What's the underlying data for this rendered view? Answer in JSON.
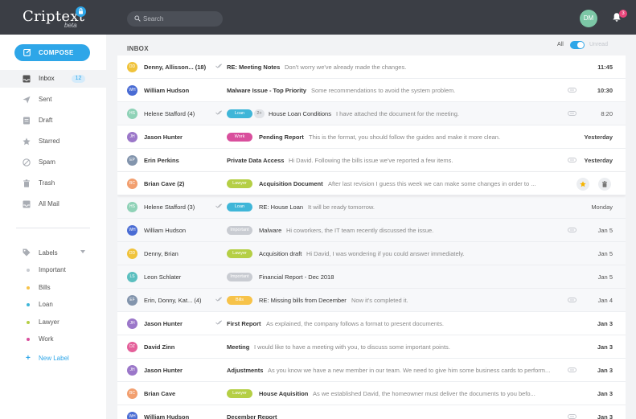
{
  "app": {
    "name": "Criptext",
    "beta": "beta",
    "icons": {
      "lock": "lock-icon",
      "search": "search-icon",
      "bell": "bell-icon"
    }
  },
  "search": {
    "placeholder": "Search"
  },
  "user": {
    "initials": "DM",
    "notification_count": "3"
  },
  "compose": {
    "label": "COMPOSE",
    "icon": "compose-icon"
  },
  "nav": [
    {
      "label": "Inbox",
      "count": "12",
      "icon": "inbox-icon"
    },
    {
      "label": "Sent",
      "icon": "send-icon"
    },
    {
      "label": "Draft",
      "icon": "draft-icon"
    },
    {
      "label": "Starred",
      "icon": "star-icon"
    },
    {
      "label": "Spam",
      "icon": "spam-icon"
    },
    {
      "label": "Trash",
      "icon": "trash-icon"
    },
    {
      "label": "All Mail",
      "icon": "all-mail-icon"
    }
  ],
  "labels": {
    "title": "Labels",
    "items": [
      {
        "name": "Important",
        "color": "#c9ccd2"
      },
      {
        "name": "Bills",
        "color": "#f7c34a"
      },
      {
        "name": "Loan",
        "color": "#3fb6d8"
      },
      {
        "name": "Lawyer",
        "color": "#b5cf45"
      },
      {
        "name": "Work",
        "color": "#d94f9d"
      }
    ],
    "new_label": "New Label"
  },
  "inbox": {
    "title": "INBOX",
    "filter_all": "All",
    "filter_unread": "Unread",
    "emails": [
      {
        "initials": "DD",
        "avatar_color": "#f0c33c",
        "from": "Denny, Allisson... (18)",
        "subject": "RE: Meeting Notes",
        "preview": "Don't worry we've already made the changes.",
        "time": "11:45",
        "unread": true,
        "check": true,
        "label": null,
        "thread": null,
        "attachment": false
      },
      {
        "initials": "WH",
        "avatar_color": "#4a6cd4",
        "from": "William Hudson",
        "subject": "Malware Issue - Top Priority",
        "preview": "Some recommendations to avoid the system problem.",
        "time": "10:30",
        "unread": true,
        "check": false,
        "label": null,
        "thread": null,
        "attachment": true
      },
      {
        "initials": "HS",
        "avatar_color": "#8fd2b7",
        "from": "Helene Stafford (4)",
        "subject": "House Loan Conditions",
        "preview": "I have attached the document for the meeting.",
        "time": "8:20",
        "unread": false,
        "check": true,
        "label": {
          "text": "Loan",
          "color": "#3fb6d8"
        },
        "thread": "2+",
        "attachment": true
      },
      {
        "initials": "JH",
        "avatar_color": "#9b77c9",
        "from": "Jason Hunter",
        "subject": "Pending Report",
        "preview": "This is the format, you should follow the guides and make it more clean.",
        "time": "Yesterday",
        "unread": true,
        "check": false,
        "label": {
          "text": "Work",
          "color": "#d94f9d"
        },
        "thread": null,
        "attachment": false
      },
      {
        "initials": "EP",
        "avatar_color": "#8395ad",
        "from": "Erin Perkins",
        "subject": "Private Data Access",
        "preview": "Hi David. Following the bills issue we've reported a few items.",
        "time": "Yesterday",
        "unread": true,
        "check": false,
        "label": null,
        "thread": null,
        "attachment": true
      },
      {
        "initials": "BC",
        "avatar_color": "#f29f6f",
        "from": "Brian Cave (2)",
        "subject": "Acquisition Document",
        "preview": "After last revision I guess this week we can make some changes in order to ...",
        "time": "",
        "unread": true,
        "check": false,
        "label": {
          "text": "Lawyer",
          "color": "#b5cf45"
        },
        "thread": null,
        "attachment": false,
        "hover": true
      },
      {
        "initials": "HS",
        "avatar_color": "#8fd2b7",
        "from": "Helene Stafford (3)",
        "subject": "RE: House Loan",
        "preview": "It will be ready tomorrow.",
        "time": "Monday",
        "unread": false,
        "check": true,
        "label": {
          "text": "Loan",
          "color": "#3fb6d8"
        },
        "thread": null,
        "attachment": false
      },
      {
        "initials": "WH",
        "avatar_color": "#4a6cd4",
        "from": "William Hudson",
        "subject": "Malware",
        "preview": "Hi coworkers, the IT team recently discussed the issue.",
        "time": "Jan 5",
        "unread": false,
        "check": false,
        "label": {
          "text": "Important",
          "color": "#c9ccd2"
        },
        "thread": null,
        "attachment": true
      },
      {
        "initials": "DD",
        "avatar_color": "#f0c33c",
        "from": "Denny, Brian",
        "subject": "Acquisition draft",
        "preview": "Hi David, I was wondering if you could answer immediately.",
        "time": "Jan 5",
        "unread": false,
        "check": false,
        "label": {
          "text": "Lawyer",
          "color": "#b5cf45"
        },
        "thread": null,
        "attachment": false
      },
      {
        "initials": "LS",
        "avatar_color": "#5bbfbf",
        "from": "Leon Schlater",
        "subject": "Financial Report - Dec 2018",
        "preview": "",
        "time": "Jan 5",
        "unread": false,
        "check": false,
        "label": {
          "text": "Important",
          "color": "#c9ccd2"
        },
        "thread": null,
        "attachment": false
      },
      {
        "initials": "EF",
        "avatar_color": "#8395ad",
        "from": "Erin, Donny, Kat... (4)",
        "subject": "RE: Missing bills from December",
        "preview": "Now it's completed it.",
        "time": "Jan 4",
        "unread": false,
        "check": true,
        "label": {
          "text": "Bills",
          "color": "#f7c34a"
        },
        "thread": null,
        "attachment": true
      },
      {
        "initials": "JH",
        "avatar_color": "#9b77c9",
        "from": "Jason Hunter",
        "subject": "First Report",
        "preview": "As explained, the company follows a format to present documents.",
        "time": "Jan 3",
        "unread": true,
        "check": true,
        "label": null,
        "thread": null,
        "attachment": false
      },
      {
        "initials": "DZ",
        "avatar_color": "#e4609a",
        "from": "David Zinn",
        "subject": "Meeting",
        "preview": "I would like to have a meeting with you, to discuss some important points.",
        "time": "Jan 3",
        "unread": true,
        "check": false,
        "label": null,
        "thread": null,
        "attachment": false
      },
      {
        "initials": "JH",
        "avatar_color": "#9b77c9",
        "from": "Jason Hunter",
        "subject": "Adjustments",
        "preview": "As you know we have a new member in our team. We need to give him some business cards to perform...",
        "time": "Jan 3",
        "unread": true,
        "check": false,
        "label": null,
        "thread": null,
        "attachment": true
      },
      {
        "initials": "BC",
        "avatar_color": "#f29f6f",
        "from": "Brian Cave",
        "subject": "House Aquisition",
        "preview": "As we established David, the homeowner must deliver the documents to you befo...",
        "time": "Jan 3",
        "unread": true,
        "check": false,
        "label": {
          "text": "Lawyer",
          "color": "#b5cf45"
        },
        "thread": null,
        "attachment": false
      },
      {
        "initials": "WH",
        "avatar_color": "#4a6cd4",
        "from": "William Hudson",
        "subject": "December Report",
        "preview": "",
        "time": "Jan 3",
        "unread": true,
        "check": false,
        "label": null,
        "thread": null,
        "attachment": true
      }
    ],
    "row_actions": [
      "star-icon",
      "trash-icon"
    ]
  }
}
